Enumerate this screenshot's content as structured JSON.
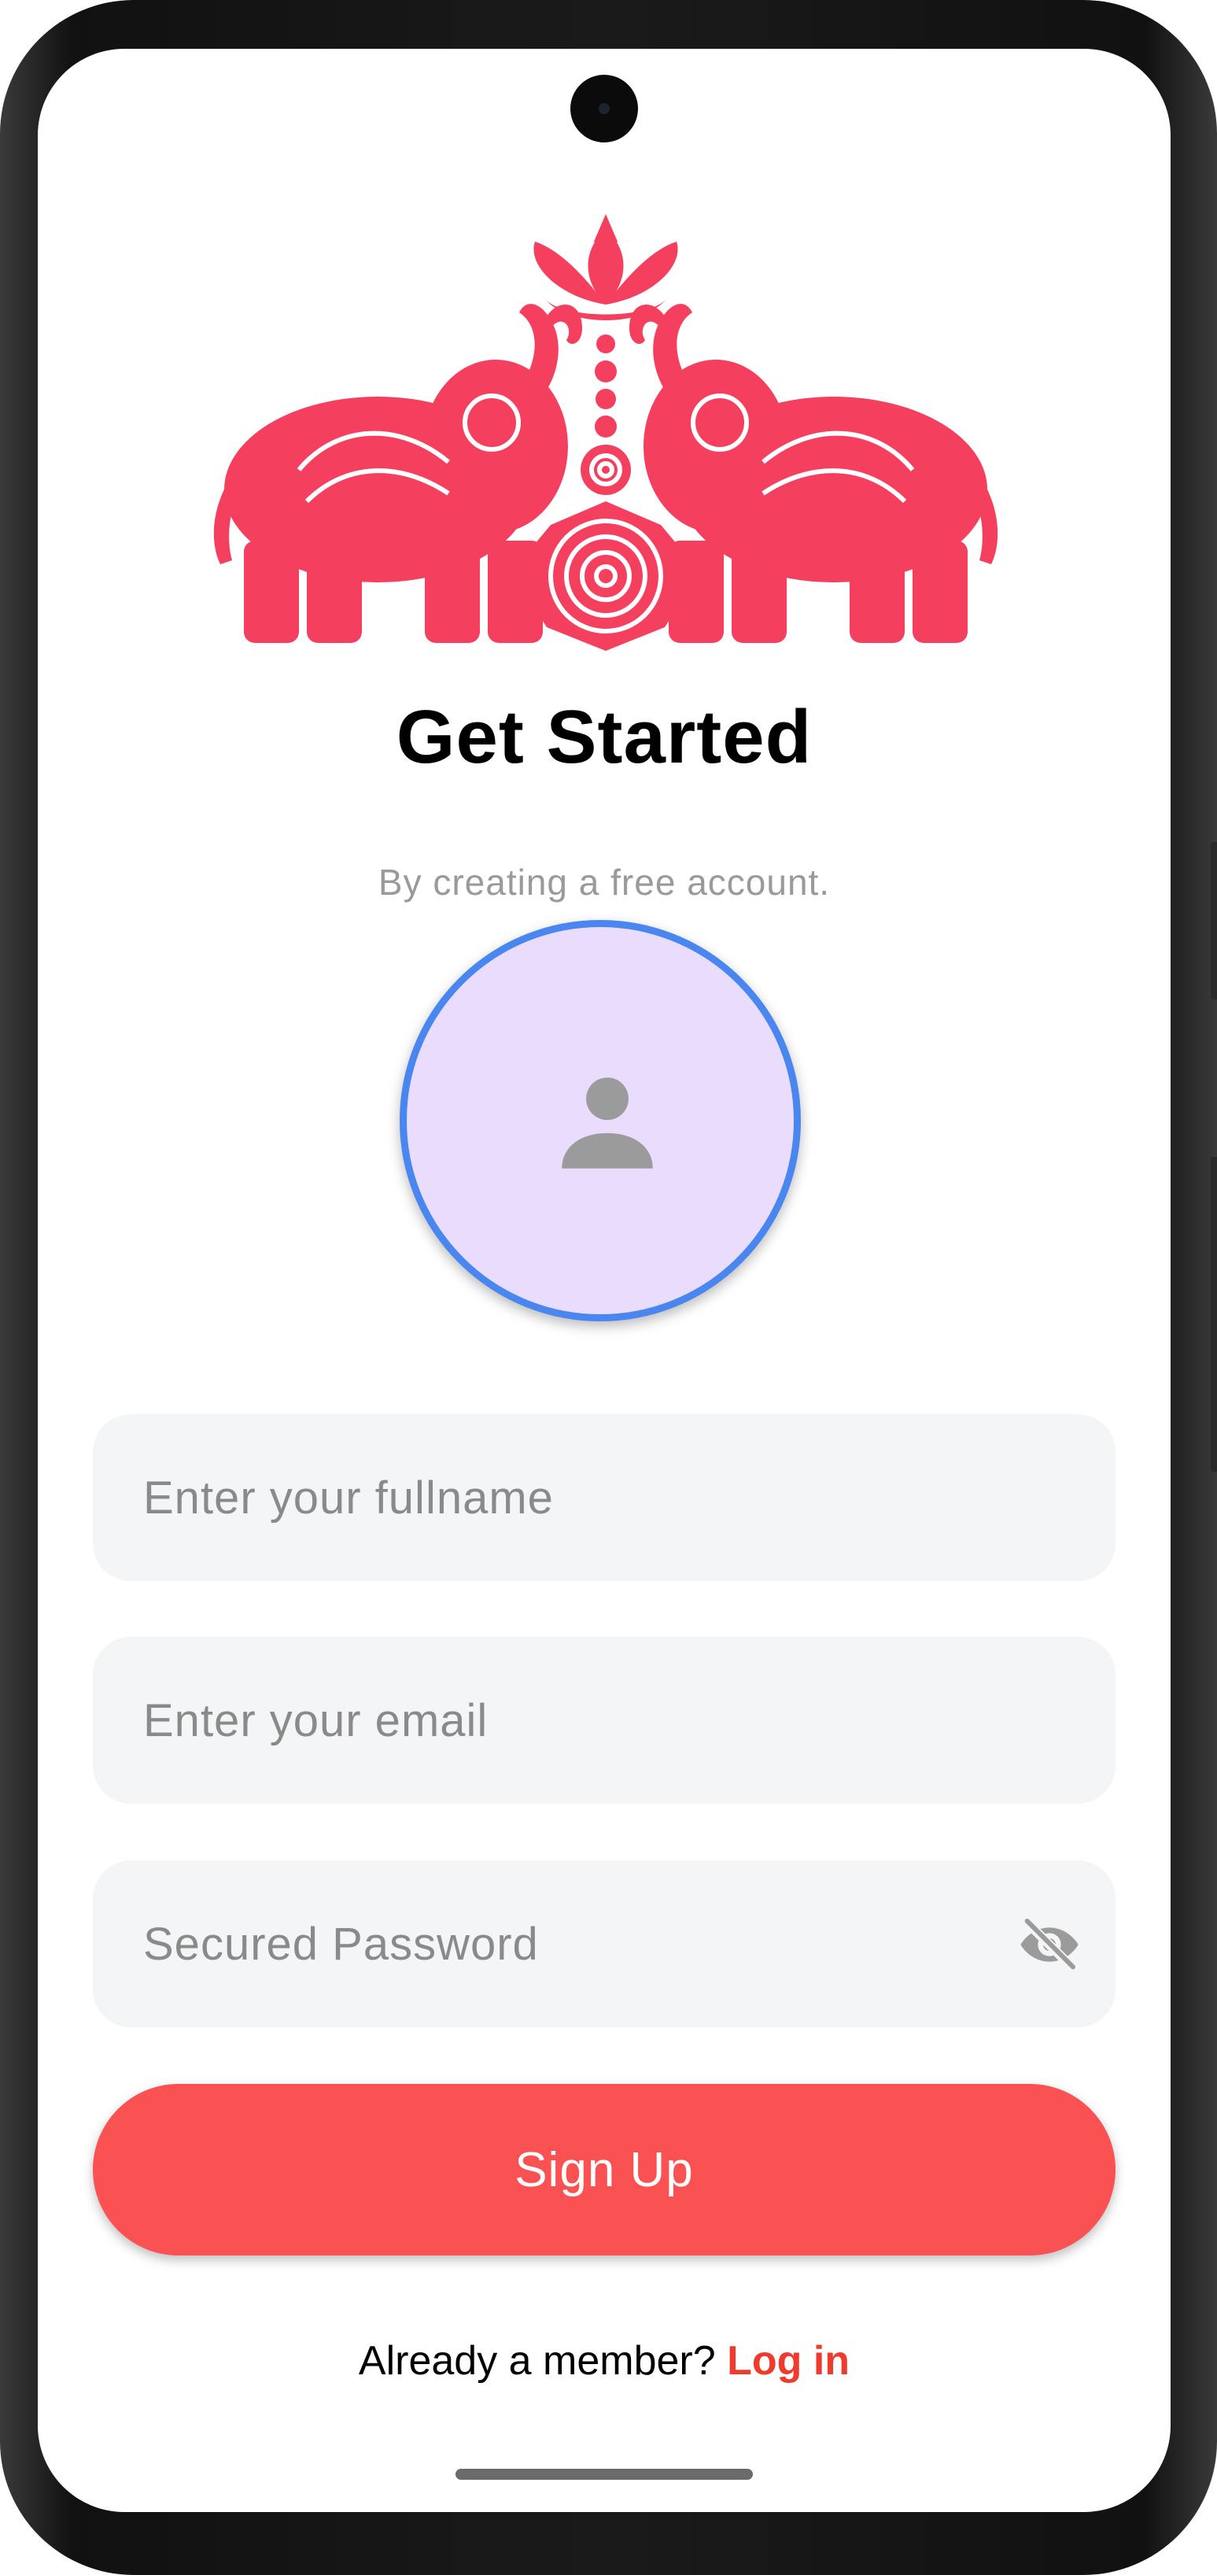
{
  "header": {
    "title": "Get Started",
    "subtitle": "By creating a free account."
  },
  "icons": {
    "logo": "elephant-logo-icon",
    "avatar": "person-icon",
    "password_toggle": "eye-off-icon"
  },
  "form": {
    "fullname_placeholder": "Enter your fullname",
    "email_placeholder": "Enter your email",
    "password_placeholder": "Secured Password",
    "submit_label": "Sign Up"
  },
  "footer": {
    "prompt": "Already a member?",
    "link_label": "Log in"
  },
  "colors": {
    "accent": "#fa5252",
    "link": "#ee3b2e",
    "avatar_border": "#4a86f0",
    "avatar_fill": "#e9dcfc",
    "logo": "#f43f5e"
  }
}
